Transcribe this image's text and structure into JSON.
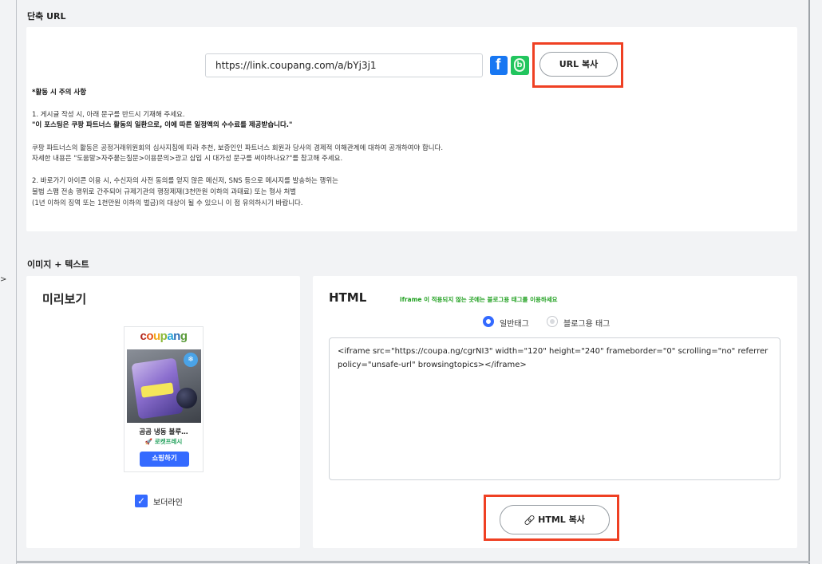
{
  "short_url": {
    "section_title": "단축 URL",
    "url_value": "https://link.coupang.com/a/bYj3j1",
    "facebook_glyph": "f",
    "blog_glyph": "b",
    "copy_button": "URL 복사"
  },
  "notice": {
    "heading": "*활동 시 주의 사항",
    "line1": "1. 게시글 작성 시, 아래 문구를 반드시 기재해 주세요.",
    "line2": "\"이 포스팅은 쿠팡 파트너스 활동의 일환으로, 이에 따른 일정액의 수수료를 제공받습니다.\"",
    "line3": "쿠팡 파트너스의 활동은 공정거래위원회의 심사지침에 따라 추천, 보증인인 파트너스 회원과 당사의 경제적 이해관계에 대하여 공개하여야 합니다.",
    "line4": "자세한 내용은 \"도움말>자주묻는질문>이용문의>광고 삽입 시 대가성 문구를 써야하나요?\"를 참고해 주세요.",
    "line5": "2. 바로가기 아이콘 이용 시, 수신자의 사전 동의를 얻지 않은 메신저, SNS 등으로 메시지를 발송하는 행위는",
    "line6": "불법 스팸 전송 행위로 간주되어 규제기관의 행정제재(3천만원 이하의 과태료) 또는 형사 처벌",
    "line7": "(1년 이하의 징역 또는 1천만원 이하의 벌금)의 대상이 될 수 있으니 이 점 유의하시기 바랍니다."
  },
  "image_text": {
    "section_title": "이미지 + 텍스트",
    "preview": {
      "title": "미리보기",
      "product_name": "곰곰 냉동 블루…",
      "rocket_label": "🚀 로켓프레시",
      "shop_button": "쇼핑하기",
      "border_line_label": "보더라인",
      "border_line_checked": true
    },
    "html": {
      "title": "HTML",
      "hint": "iframe 이 적용되지 않는 곳에는 블로그용 태그를 이용하세요",
      "radio_general": "일반태그",
      "radio_blog": "블로그용 태그",
      "selected_radio": "일반태그",
      "code": "<iframe src=\"https://coupa.ng/cgrNI3\" width=\"120\" height=\"240\" frameborder=\"0\" scrolling=\"no\" referrerpolicy=\"unsafe-url\" browsingtopics></iframe>",
      "copy_button": "HTML 복사"
    }
  },
  "side_mark": ">",
  "colors": {
    "highlight": "#ef4023",
    "primary": "#346aff",
    "hint_green": "#20a020",
    "facebook": "#1877f2",
    "blog": "#22c55e"
  }
}
